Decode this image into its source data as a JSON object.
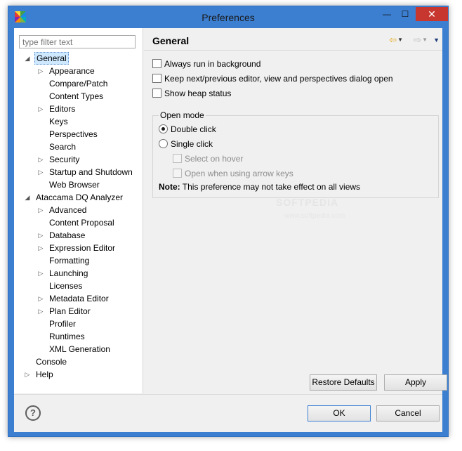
{
  "window": {
    "title": "Preferences",
    "controls": {
      "minimize": "—",
      "maximize": "☐",
      "close": "✕"
    },
    "colors": {
      "frame": "#3c7fd1",
      "close": "#c7372f",
      "selection": "#cde8ff"
    }
  },
  "filter": {
    "placeholder": "type filter text"
  },
  "tree": {
    "items": [
      {
        "label": "General",
        "level": 0,
        "expander": "◢",
        "selected": true
      },
      {
        "label": "Appearance",
        "level": 1,
        "expander": "▷"
      },
      {
        "label": "Compare/Patch",
        "level": 1,
        "expander": ""
      },
      {
        "label": "Content Types",
        "level": 1,
        "expander": ""
      },
      {
        "label": "Editors",
        "level": 1,
        "expander": "▷"
      },
      {
        "label": "Keys",
        "level": 1,
        "expander": ""
      },
      {
        "label": "Perspectives",
        "level": 1,
        "expander": ""
      },
      {
        "label": "Search",
        "level": 1,
        "expander": ""
      },
      {
        "label": "Security",
        "level": 1,
        "expander": "▷"
      },
      {
        "label": "Startup and Shutdown",
        "level": 1,
        "expander": "▷"
      },
      {
        "label": "Web Browser",
        "level": 1,
        "expander": ""
      },
      {
        "label": "Ataccama DQ Analyzer",
        "level": 0,
        "expander": "◢"
      },
      {
        "label": "Advanced",
        "level": 1,
        "expander": "▷"
      },
      {
        "label": "Content Proposal",
        "level": 1,
        "expander": ""
      },
      {
        "label": "Database",
        "level": 1,
        "expander": "▷"
      },
      {
        "label": "Expression Editor",
        "level": 1,
        "expander": "▷"
      },
      {
        "label": "Formatting",
        "level": 1,
        "expander": ""
      },
      {
        "label": "Launching",
        "level": 1,
        "expander": "▷"
      },
      {
        "label": "Licenses",
        "level": 1,
        "expander": ""
      },
      {
        "label": "Metadata Editor",
        "level": 1,
        "expander": "▷"
      },
      {
        "label": "Plan Editor",
        "level": 1,
        "expander": "▷"
      },
      {
        "label": "Profiler",
        "level": 1,
        "expander": ""
      },
      {
        "label": "Runtimes",
        "level": 1,
        "expander": ""
      },
      {
        "label": "XML Generation",
        "level": 1,
        "expander": ""
      },
      {
        "label": "Console",
        "level": 0,
        "expander": ""
      },
      {
        "label": "Help",
        "level": 0,
        "expander": "▷"
      }
    ]
  },
  "page": {
    "title": "General",
    "nav": {
      "back": "⇦",
      "back_dropdown": "▼",
      "forward": "⇨",
      "forward_dropdown": "▼",
      "menu": "▼"
    },
    "options": [
      {
        "label": "Always run in background",
        "checked": false
      },
      {
        "label": "Keep next/previous editor, view and perspectives dialog open",
        "checked": false
      },
      {
        "label": "Show heap status",
        "checked": false
      }
    ],
    "open_mode": {
      "title": "Open mode",
      "double_click": "Double click",
      "single_click": "Single click",
      "select_on_hover": "Select on hover",
      "open_arrow_keys": "Open when using arrow keys",
      "selected": "double_click"
    },
    "note_label": "Note:",
    "note_text": "This preference may not take effect on all views",
    "restore_defaults": "Restore Defaults",
    "apply": "Apply"
  },
  "watermark": {
    "text": "SOFTPEDIA",
    "sub": "www.softpedia.com"
  },
  "footer": {
    "help": "?",
    "ok": "OK",
    "cancel": "Cancel"
  }
}
